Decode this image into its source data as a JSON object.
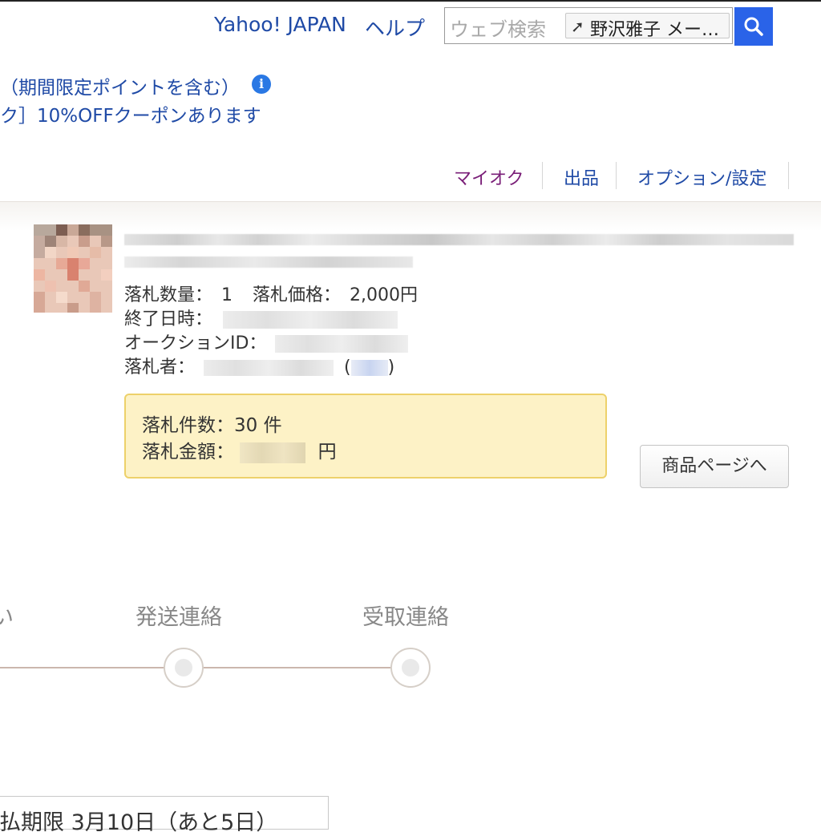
{
  "header": {
    "yahoo_japan_link": "Yahoo! JAPAN",
    "help_link": "ヘルプ",
    "search": {
      "placeholder": "ウェブ検索",
      "chip_text": "野沢雅子 メー…",
      "chip_icon": "up-arrow-icon",
      "button_icon": "search-icon",
      "button_color": "#2a63e8"
    }
  },
  "notice": {
    "points_line": "（期間限定ポイントを含む）",
    "coupon_line": "ク］10%OFFクーポンあります",
    "info_icon": "i"
  },
  "subnav": {
    "items": [
      {
        "label": "マイオク",
        "color": "#7a1f78"
      },
      {
        "label": "出品",
        "color": "#1f4aa6"
      },
      {
        "label": "オプション/設定",
        "color": "#1f4aa6"
      }
    ]
  },
  "item": {
    "quantity_label": "落札数量：",
    "quantity_value": "1",
    "price_label": "落札価格：",
    "price_value": "2,000円",
    "end_date_label": "終了日時：",
    "auction_id_label": "オークションID：",
    "winner_label": "落札者：",
    "winner_paren_open": "(",
    "winner_paren_close": ")"
  },
  "summary": {
    "count_label": "落札件数：",
    "count_value": "30 件",
    "amount_label": "落札金額：",
    "amount_unit": "円",
    "border_color": "#edd16a",
    "background_color": "#fdf2c6"
  },
  "item_page_button": "商品ページへ",
  "progress": {
    "partial_label": "い",
    "steps": [
      "発送連絡",
      "受取連絡"
    ]
  },
  "deadline": {
    "text": "払期限 3月10日（あと5日）"
  }
}
